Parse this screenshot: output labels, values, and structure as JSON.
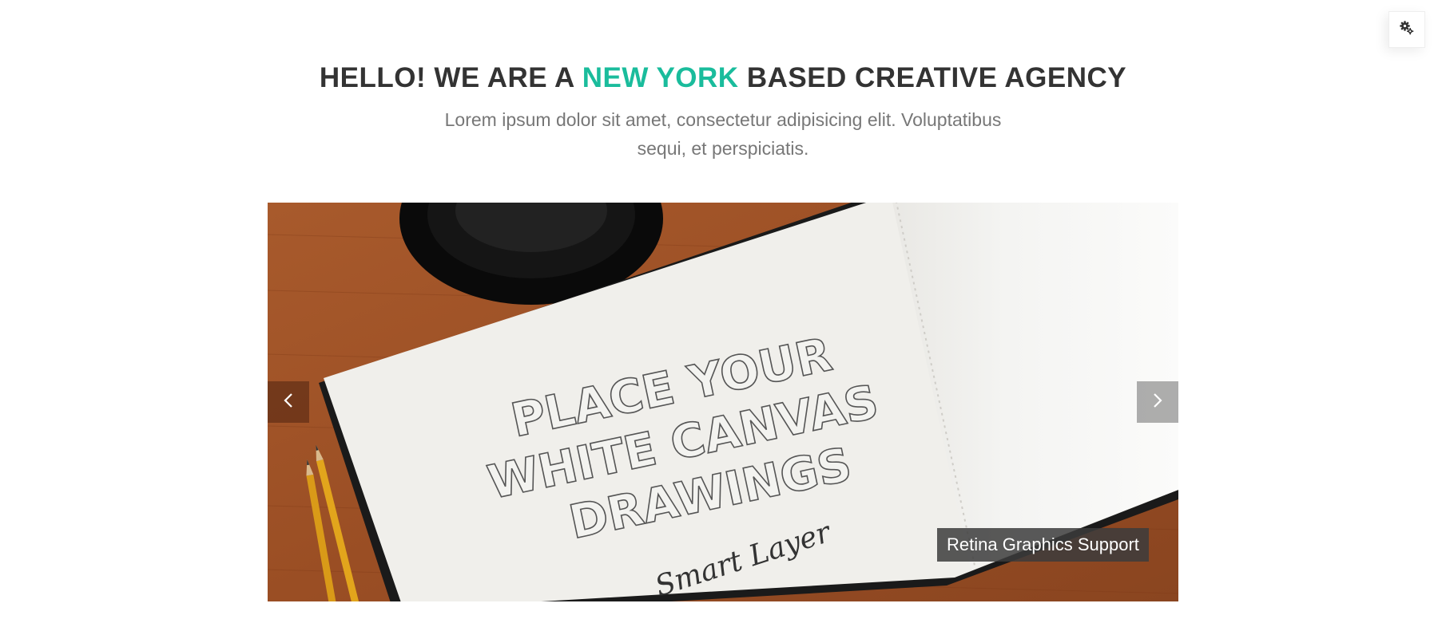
{
  "heading": {
    "before": "HELLO! WE ARE A ",
    "accent": "NEW YORK",
    "after": " BASED CREATIVE AGENCY"
  },
  "subtitle": "Lorem ipsum dolor sit amet, consectetur adipisicing elit. Voluptatibus sequi, et perspiciatis.",
  "settings": {
    "icon": "gear-icon"
  },
  "slider": {
    "caption": "Retina Graphics Support",
    "prev_icon": "chevron-left-icon",
    "next_icon": "chevron-right-icon",
    "sketch_lines": [
      "PLACE YOUR",
      "WHITE CANVAS",
      "DRAWINGS"
    ],
    "sketch_script": "Smart Layer"
  },
  "colors": {
    "accent": "#1abc9c",
    "heading": "#333333",
    "subtitle": "#777777"
  }
}
